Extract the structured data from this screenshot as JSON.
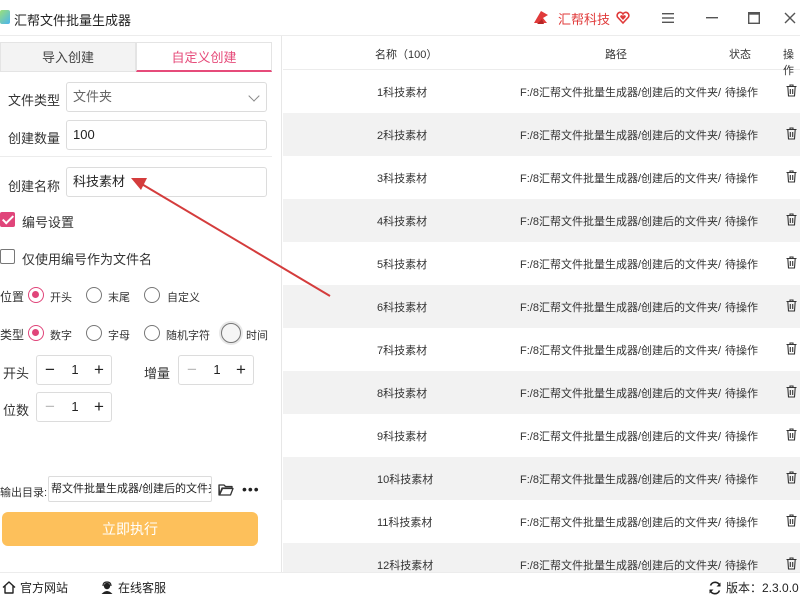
{
  "window": {
    "title": "汇帮文件批量生成器",
    "brand_name": "汇帮科技"
  },
  "tabs": [
    {
      "label": "导入创建",
      "active": false
    },
    {
      "label": "自定义创建",
      "active": true
    }
  ],
  "form": {
    "file_type_label": "文件类型",
    "file_type_value": "文件夹",
    "count_label": "创建数量",
    "count_value": "100",
    "name_label": "创建名称",
    "name_value": "科技素材",
    "numbering_label": "编号设置",
    "numbering_checked": true,
    "only_number_label": "仅使用编号作为文件名",
    "only_number_checked": false,
    "position_label": "位置",
    "position_options": [
      "开头",
      "末尾",
      "自定义"
    ],
    "position_selected": "开头",
    "type_label": "类型",
    "type_options": [
      "数字",
      "字母",
      "随机字符",
      "时间"
    ],
    "type_selected": "数字",
    "start_label": "开头",
    "start_value": "1",
    "increment_label": "增量",
    "increment_value": "1",
    "digits_label": "位数",
    "digits_value": "1",
    "output_label": "输出目录:",
    "output_value": "帮文件批量生成器/创建后的文件夹",
    "run_label": "立即执行"
  },
  "table": {
    "columns": [
      "名称（100）",
      "路径",
      "状态",
      "操作"
    ],
    "rows": [
      {
        "name": "1科技素材",
        "path": "F:/8汇帮文件批量生成器/创建后的文件夹/",
        "status": "待操作"
      },
      {
        "name": "2科技素材",
        "path": "F:/8汇帮文件批量生成器/创建后的文件夹/",
        "status": "待操作"
      },
      {
        "name": "3科技素材",
        "path": "F:/8汇帮文件批量生成器/创建后的文件夹/",
        "status": "待操作"
      },
      {
        "name": "4科技素材",
        "path": "F:/8汇帮文件批量生成器/创建后的文件夹/",
        "status": "待操作"
      },
      {
        "name": "5科技素材",
        "path": "F:/8汇帮文件批量生成器/创建后的文件夹/",
        "status": "待操作"
      },
      {
        "name": "6科技素材",
        "path": "F:/8汇帮文件批量生成器/创建后的文件夹/",
        "status": "待操作"
      },
      {
        "name": "7科技素材",
        "path": "F:/8汇帮文件批量生成器/创建后的文件夹/",
        "status": "待操作"
      },
      {
        "name": "8科技素材",
        "path": "F:/8汇帮文件批量生成器/创建后的文件夹/",
        "status": "待操作"
      },
      {
        "name": "9科技素材",
        "path": "F:/8汇帮文件批量生成器/创建后的文件夹/",
        "status": "待操作"
      },
      {
        "name": "10科技素材",
        "path": "F:/8汇帮文件批量生成器/创建后的文件夹/",
        "status": "待操作"
      },
      {
        "name": "11科技素材",
        "path": "F:/8汇帮文件批量生成器/创建后的文件夹/",
        "status": "待操作"
      },
      {
        "name": "12科技素材",
        "path": "F:/8汇帮文件批量生成器/创建后的文件夹/",
        "status": "待操作"
      }
    ]
  },
  "footer": {
    "website_label": "官方网站",
    "support_label": "在线客服",
    "version_label": "版本：2.3.0.0"
  },
  "colors": {
    "accent": "#e0457a",
    "run_button": "#fdc05b",
    "brand": "#e03a3a",
    "row_alt": "#f2f2f2"
  },
  "icons": [
    "app-logo-icon",
    "brand-logo-icon",
    "heart-shield-icon",
    "menu-icon",
    "minimize-icon",
    "maximize-icon",
    "close-icon",
    "chevron-down-icon",
    "folder-icon",
    "more-icon",
    "trash-icon",
    "home-icon",
    "user-support-icon",
    "refresh-icon"
  ]
}
